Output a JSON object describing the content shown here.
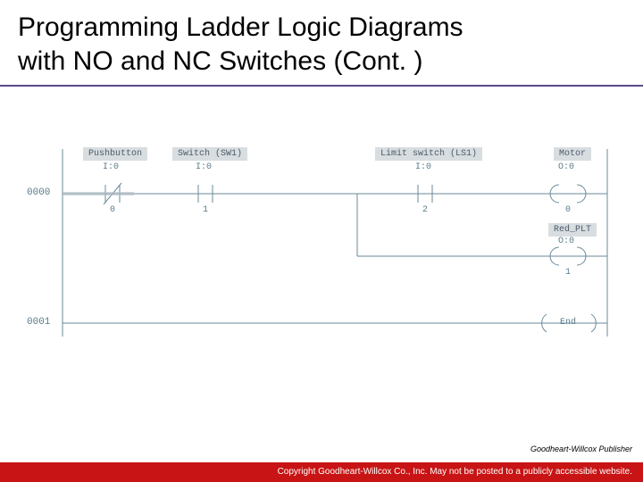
{
  "title_line1": "Programming Ladder Logic Diagrams",
  "title_line2": "with NO and NC Switches (Cont. )",
  "rungs": {
    "r0": "0000",
    "r1": "0001"
  },
  "elements": {
    "pushbutton": {
      "label": "Pushbutton",
      "addr": "I:0",
      "bit": "0"
    },
    "switch_sw1": {
      "label": "Switch (SW1)",
      "addr": "I:0",
      "bit": "1"
    },
    "limit_switch": {
      "label": "Limit switch (LS1)",
      "addr": "I:0",
      "bit": "2"
    },
    "motor": {
      "label": "Motor",
      "addr": "O:0",
      "bit": "0"
    },
    "red_plt": {
      "label": "Red_PLT",
      "addr": "O:0",
      "bit": "1"
    },
    "end": {
      "label": "End"
    }
  },
  "publisher": "Goodheart-Willcox Publisher",
  "footer": "Copyright Goodheart-Willcox Co., Inc.  May not be posted to a publicly accessible website."
}
